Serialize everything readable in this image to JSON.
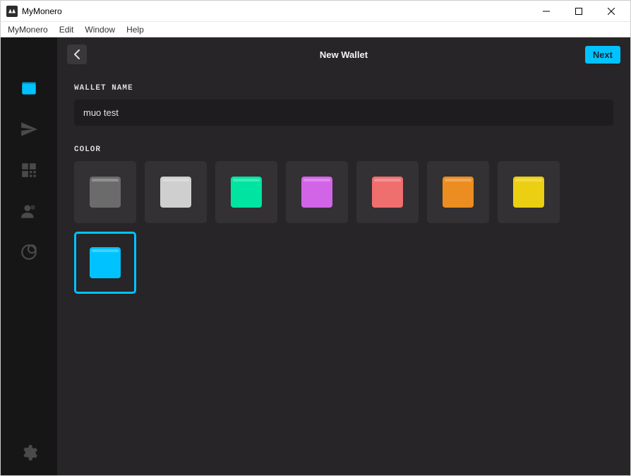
{
  "window": {
    "title": "MyMonero"
  },
  "menubar": {
    "items": [
      "MyMonero",
      "Edit",
      "Window",
      "Help"
    ]
  },
  "sidebar": {
    "items": [
      {
        "name": "wallet-icon",
        "active": true
      },
      {
        "name": "send-icon",
        "active": false
      },
      {
        "name": "qr-icon",
        "active": false
      },
      {
        "name": "contacts-icon",
        "active": false
      },
      {
        "name": "exchange-icon",
        "active": false
      }
    ],
    "bottom": {
      "name": "settings-icon"
    }
  },
  "topbar": {
    "title": "New Wallet",
    "next_label": "Next"
  },
  "form": {
    "wallet_name_label": "WALLET NAME",
    "wallet_name_value": "muo test",
    "color_label": "COLOR",
    "colors": [
      {
        "name": "dark-grey",
        "hex": "#6b6b6b",
        "selected": false
      },
      {
        "name": "light-grey",
        "hex": "#cfcfcf",
        "selected": false
      },
      {
        "name": "teal",
        "hex": "#00e4a1",
        "selected": false
      },
      {
        "name": "magenta",
        "hex": "#d264e8",
        "selected": false
      },
      {
        "name": "coral",
        "hex": "#ef6e6e",
        "selected": false
      },
      {
        "name": "orange",
        "hex": "#eb8d20",
        "selected": false
      },
      {
        "name": "yellow",
        "hex": "#ebcf12",
        "selected": false
      },
      {
        "name": "cyan",
        "hex": "#00c2ff",
        "selected": true
      }
    ]
  }
}
